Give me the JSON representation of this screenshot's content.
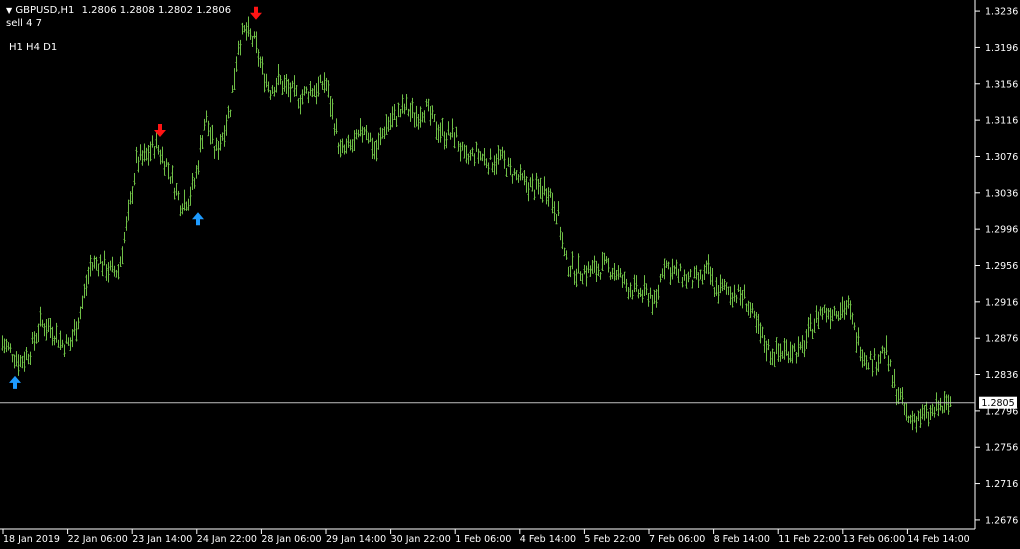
{
  "header": {
    "symbol": "GBPUSD,H1",
    "quote": "1.2806 1.2808 1.2802 1.2806",
    "signal_line": "sell 4 7",
    "timeframes": "H1 H4 D1"
  },
  "current_price_label": "1.2805",
  "colors": {
    "background": "#000000",
    "bar": "#6ebe46",
    "axis": "#ffffff",
    "buy_arrow": "#1e9bff",
    "sell_arrow": "#ff1414",
    "price_line": "#c0c0c0"
  },
  "chart_data": {
    "type": "bar",
    "symbol": "GBPUSD",
    "timeframe": "H1",
    "ylim": [
      1.2666,
      1.3246
    ],
    "y_ticks": [
      "1.3236",
      "1.3196",
      "1.3156",
      "1.3116",
      "1.3076",
      "1.3036",
      "1.2996",
      "1.2956",
      "1.2916",
      "1.2876",
      "1.2836",
      "1.2796",
      "1.2756",
      "1.2716",
      "1.2676"
    ],
    "x_ticks": [
      "18 Jan 2019",
      "22 Jan 06:00",
      "23 Jan 14:00",
      "24 Jan 22:00",
      "28 Jan 06:00",
      "29 Jan 14:00",
      "30 Jan 22:00",
      "1 Feb 06:00",
      "4 Feb 14:00",
      "5 Feb 22:00",
      "7 Feb 06:00",
      "8 Feb 14:00",
      "11 Feb 22:00",
      "13 Feb 06:00",
      "14 Feb 14:00"
    ],
    "current_price": 1.2805,
    "series": [
      {
        "anchors": [
          [
            0,
            1.2873
          ],
          [
            10,
            1.2862
          ],
          [
            20,
            1.285
          ],
          [
            30,
            1.2862
          ],
          [
            40,
            1.2892
          ],
          [
            50,
            1.2888
          ],
          [
            62,
            1.287
          ],
          [
            70,
            1.287
          ],
          [
            80,
            1.2905
          ],
          [
            90,
            1.2955
          ],
          [
            100,
            1.296
          ],
          [
            110,
            1.295
          ],
          [
            118,
            1.295
          ],
          [
            128,
            1.301
          ],
          [
            136,
            1.307
          ],
          [
            145,
            1.3075
          ],
          [
            155,
            1.309
          ],
          [
            165,
            1.307
          ],
          [
            172,
            1.305
          ],
          [
            180,
            1.3025
          ],
          [
            188,
            1.303
          ],
          [
            195,
            1.305
          ],
          [
            205,
            1.312
          ],
          [
            215,
            1.308
          ],
          [
            222,
            1.31
          ],
          [
            230,
            1.313
          ],
          [
            238,
            1.32
          ],
          [
            245,
            1.3215
          ],
          [
            255,
            1.32
          ],
          [
            262,
            1.317
          ],
          [
            270,
            1.315
          ],
          [
            278,
            1.316
          ],
          [
            288,
            1.315
          ],
          [
            300,
            1.314
          ],
          [
            310,
            1.315
          ],
          [
            318,
            1.315
          ],
          [
            325,
            1.316
          ],
          [
            333,
            1.312
          ],
          [
            340,
            1.308
          ],
          [
            348,
            1.3085
          ],
          [
            355,
            1.309
          ],
          [
            365,
            1.311
          ],
          [
            375,
            1.308
          ],
          [
            385,
            1.311
          ],
          [
            395,
            1.312
          ],
          [
            405,
            1.313
          ],
          [
            415,
            1.312
          ],
          [
            425,
            1.313
          ],
          [
            435,
            1.311
          ],
          [
            445,
            1.31
          ],
          [
            455,
            1.31
          ],
          [
            465,
            1.307
          ],
          [
            475,
            1.308
          ],
          [
            490,
            1.307
          ],
          [
            500,
            1.3075
          ],
          [
            510,
            1.306
          ],
          [
            520,
            1.305
          ],
          [
            535,
            1.304
          ],
          [
            548,
            1.304
          ],
          [
            558,
            1.301
          ],
          [
            565,
            1.296
          ],
          [
            575,
            1.295
          ],
          [
            590,
            1.295
          ],
          [
            605,
            1.2955
          ],
          [
            615,
            1.295
          ],
          [
            625,
            1.2935
          ],
          [
            640,
            1.2925
          ],
          [
            650,
            1.2925
          ],
          [
            655,
            1.291
          ],
          [
            663,
            1.296
          ],
          [
            672,
            1.295
          ],
          [
            680,
            1.2945
          ],
          [
            690,
            1.294
          ],
          [
            700,
            1.294
          ],
          [
            708,
            1.295
          ],
          [
            715,
            1.293
          ],
          [
            725,
            1.293
          ],
          [
            735,
            1.2925
          ],
          [
            745,
            1.292
          ],
          [
            752,
            1.29
          ],
          [
            760,
            1.288
          ],
          [
            770,
            1.286
          ],
          [
            780,
            1.286
          ],
          [
            790,
            1.2865
          ],
          [
            800,
            1.286
          ],
          [
            810,
            1.2885
          ],
          [
            820,
            1.2905
          ],
          [
            830,
            1.2905
          ],
          [
            840,
            1.291
          ],
          [
            848,
            1.291
          ],
          [
            855,
            1.288
          ],
          [
            865,
            1.2855
          ],
          [
            875,
            1.285
          ],
          [
            885,
            1.2865
          ],
          [
            892,
            1.283
          ],
          [
            900,
            1.281
          ],
          [
            908,
            1.2785
          ],
          [
            918,
            1.279
          ],
          [
            928,
            1.279
          ],
          [
            938,
            1.28
          ],
          [
            946,
            1.28
          ],
          [
            950,
            1.2806
          ]
        ]
      }
    ],
    "signals": [
      {
        "type": "buy",
        "bar_x": 15,
        "price": 1.285
      },
      {
        "type": "sell",
        "bar_x": 160,
        "price": 1.3093
      },
      {
        "type": "buy",
        "bar_x": 198,
        "price": 1.303
      },
      {
        "type": "sell",
        "bar_x": 256,
        "price": 1.3222
      }
    ]
  }
}
